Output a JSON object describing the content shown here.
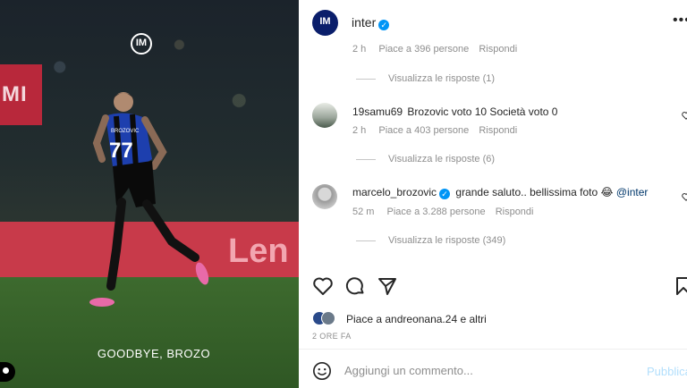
{
  "media": {
    "caption": "GOODBYE, BROZO",
    "banner_left_text": "MI",
    "board_text": "Len",
    "logo_text": "IM",
    "jersey_number": "77",
    "jersey_name": "BROZOVIC"
  },
  "header": {
    "username": "inter",
    "avatar_text": "IM",
    "more_label": "•••"
  },
  "comments": {
    "top_meta": {
      "time": "2 h",
      "likes": "Piace a 396 persone",
      "reply": "Rispondi"
    },
    "top_replies": "Visualizza le risposte (1)",
    "items": [
      {
        "user": "19samu69",
        "text": "Brozovic voto 10 Società voto 0",
        "time": "2 h",
        "likes": "Piace a 403 persone",
        "reply": "Rispondi",
        "replies": "Visualizza le risposte (6)"
      },
      {
        "user": "marcelo_brozovic",
        "text": "grande saluto.. bellissima foto 😂",
        "mention": "@inter",
        "time": "52 m",
        "likes": "Piace a 3.288 persone",
        "reply": "Rispondi",
        "replies": "Visualizza le risposte (349)"
      }
    ]
  },
  "likes": {
    "prefix": "Piace a",
    "user": "andreonana.24",
    "suffix": "e altri"
  },
  "time_ago": "2 ORE FA",
  "comment_box": {
    "placeholder": "Aggiungi un commento...",
    "publish_label": "Pubblica"
  },
  "colors": {
    "inter_blue": "#0a1e6b",
    "verified_blue": "#0095f6",
    "publish_disabled": "#b2dffc"
  }
}
